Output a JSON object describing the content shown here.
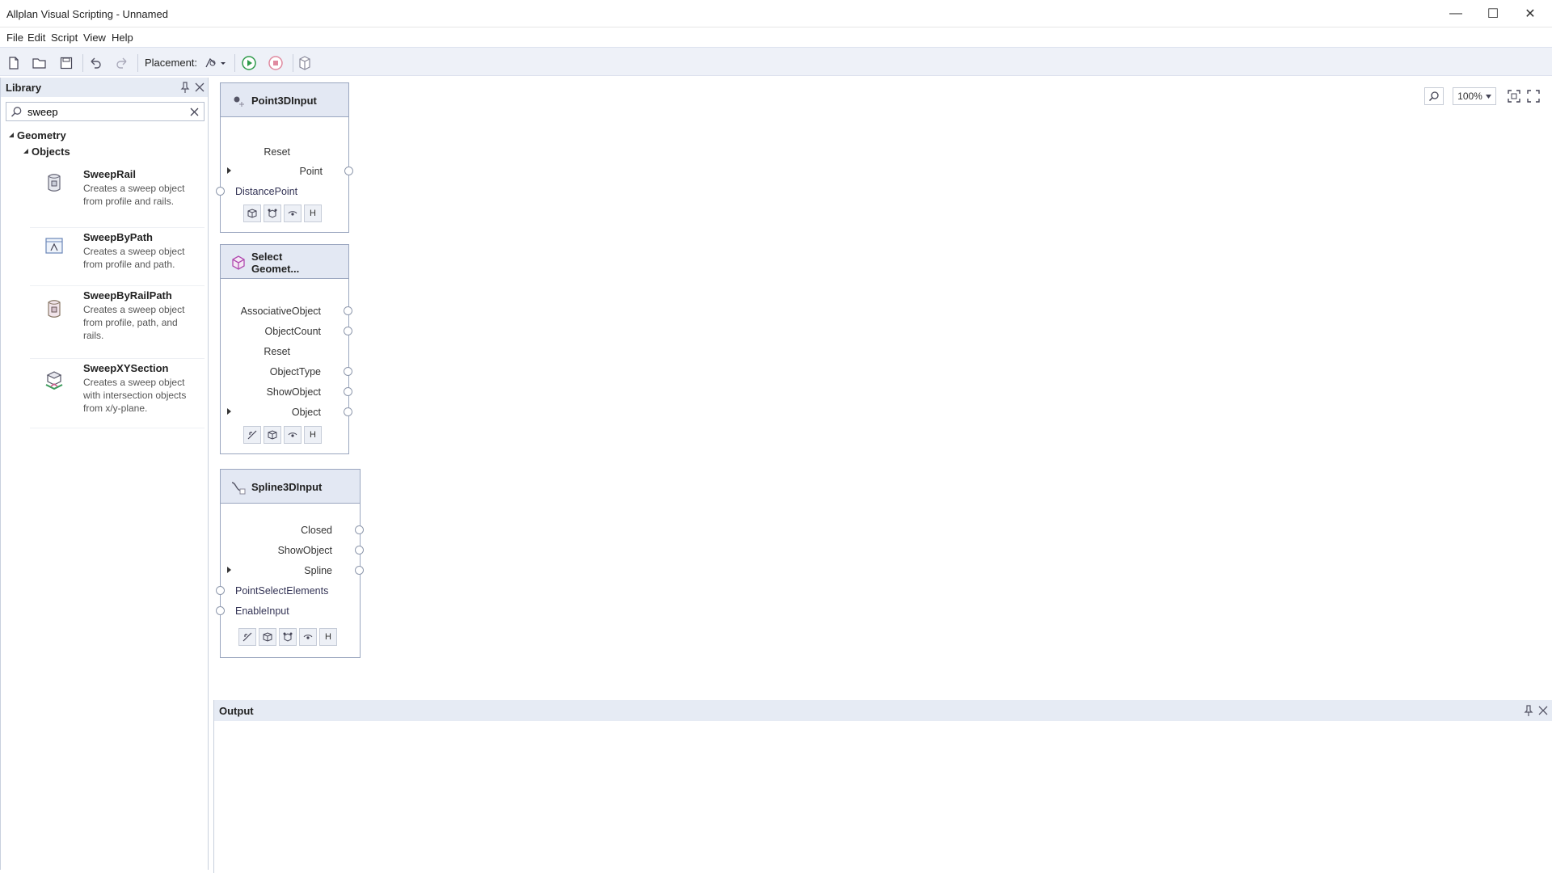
{
  "window": {
    "title": "Allplan Visual Scripting - Unnamed",
    "minimize": "—",
    "maximize": "☐",
    "close": "✕"
  },
  "menu": [
    "File",
    "Edit",
    "Script",
    "View",
    "Help"
  ],
  "toolbar": {
    "placement_label": "Placement:"
  },
  "library": {
    "title": "Library",
    "pin_icon": "pin-icon",
    "close_icon": "close-icon",
    "search": {
      "value": "sweep",
      "placeholder": ""
    },
    "tree": {
      "root": "Geometry",
      "child": "Objects"
    },
    "items": [
      {
        "name": "SweepRail",
        "desc": "Creates a sweep object from profile and rails."
      },
      {
        "name": "SweepByPath",
        "desc": "Creates a sweep object from profile and path."
      },
      {
        "name": "SweepByRailPath",
        "desc": "Creates a sweep object from profile, path, and rails."
      },
      {
        "name": "SweepXYSection",
        "desc": "Creates a sweep object with intersection objects from x/y-plane."
      }
    ]
  },
  "canvas": {
    "zoom_level": "100%",
    "nodes": {
      "point3d": {
        "title": "Point3DInput",
        "ports": {
          "reset": "Reset",
          "point": "Point",
          "distance_point": "DistancePoint"
        },
        "icon_h": "H"
      },
      "select_geometry": {
        "title_line1": "Select",
        "title_line2": "Geomet...",
        "ports": {
          "associative_object": "AssociativeObject",
          "object_count": "ObjectCount",
          "reset": "Reset",
          "object_type": "ObjectType",
          "show_object": "ShowObject",
          "object": "Object"
        },
        "icon_h": "H"
      },
      "spline3d": {
        "title": "Spline3DInput",
        "ports": {
          "closed": "Closed",
          "show_object": "ShowObject",
          "spline": "Spline",
          "point_select_elements": "PointSelectElements",
          "enable_input": "EnableInput"
        },
        "icon_h": "H"
      }
    }
  },
  "output": {
    "title": "Output"
  }
}
